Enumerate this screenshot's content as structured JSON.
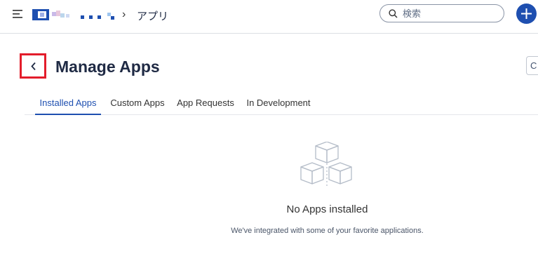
{
  "header": {
    "breadcrumb_separator": "›",
    "current_app": "アプリ",
    "search_placeholder": "検索",
    "accent_color": "#1e4fb0"
  },
  "page": {
    "title": "Manage Apps",
    "corner_button_label": "C"
  },
  "tabs": [
    {
      "label": "Installed Apps",
      "active": true
    },
    {
      "label": "Custom Apps",
      "active": false
    },
    {
      "label": "App Requests",
      "active": false
    },
    {
      "label": "In Development",
      "active": false
    }
  ],
  "empty_state": {
    "icon": "cubes-icon",
    "title": "No Apps installed",
    "description": "We've integrated with some of your favorite applications."
  }
}
